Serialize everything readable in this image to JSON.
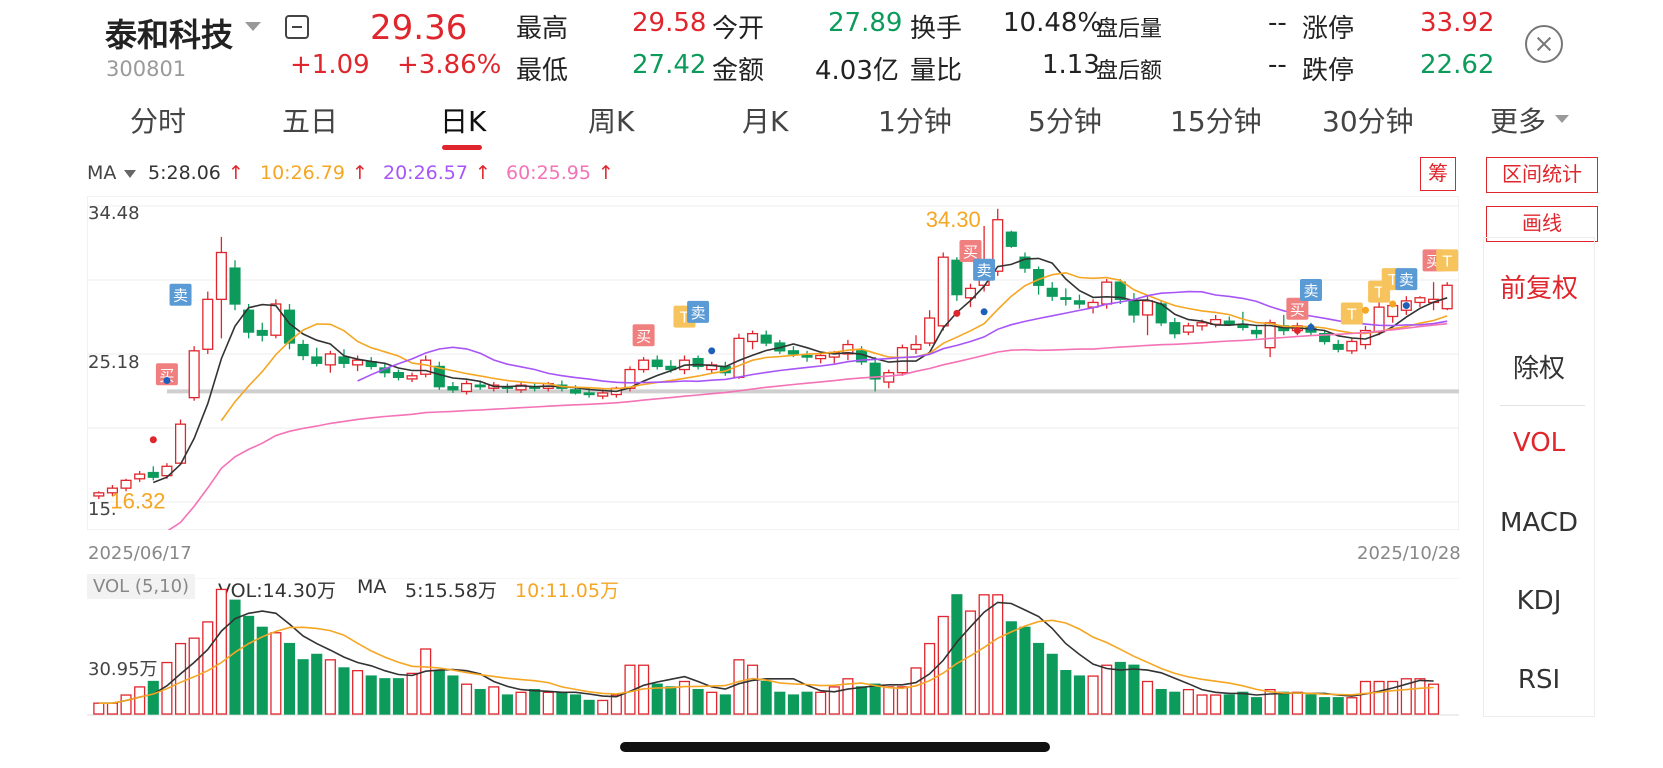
{
  "stock": {
    "name": "泰和科技",
    "code": "300801",
    "price": "29.36",
    "change": "+1.09",
    "change_pct": "+3.86%"
  },
  "quote": {
    "high_label": "最高",
    "high": "29.58",
    "low_label": "最低",
    "low": "27.42",
    "open_label": "今开",
    "open": "27.89",
    "amount_label": "金额",
    "amount": "4.03亿",
    "turnover_label": "换手",
    "turnover": "10.48%",
    "volratio_label": "量比",
    "volratio": "1.13",
    "after_vol_label": "盘后量",
    "after_vol": "--",
    "after_amt_label": "盘后额",
    "after_amt": "--",
    "limit_up_label": "涨停",
    "limit_up": "33.92",
    "limit_down_label": "跌停",
    "limit_down": "22.62"
  },
  "tabs": [
    "分时",
    "五日",
    "日K",
    "周K",
    "月K",
    "1分钟",
    "5分钟",
    "15分钟",
    "30分钟",
    "更多"
  ],
  "active_tab": "日K",
  "ma": {
    "label": "MA",
    "ma5": "5:28.06",
    "ma10": "10:26.79",
    "ma20": "20:26.57",
    "ma60": "60:25.95",
    "colors": {
      "ma5": "#333333",
      "ma10": "#f5a623",
      "ma20": "#a855f7",
      "ma60": "#f472b6"
    }
  },
  "right_buttons": {
    "chip": "筹",
    "interval_stats": "区间统计",
    "draw_line": "画线"
  },
  "side_menu": [
    "前复权",
    "除权",
    "VOL",
    "MACD",
    "KDJ",
    "RSI"
  ],
  "side_menu_active": [
    "前复权",
    "VOL"
  ],
  "axis": {
    "y_top": "34.48",
    "y_mid": "25.18",
    "y_low": "15.",
    "start_date": "2025/06/17",
    "end_date": "2025/10/28"
  },
  "annotations": {
    "max_price": "34.30",
    "min_price": "16.32",
    "buy": "买",
    "sell": "卖",
    "t": "T"
  },
  "vol": {
    "badge": "VOL (5,10)",
    "value": "VOL:14.30万",
    "ma_label": "MA",
    "ma5": "5:15.58万",
    "ma10": "10:11.05万",
    "axis_label": "30.95万"
  },
  "colors": {
    "up": "#e0262d",
    "down": "#0d9b5c",
    "accent": "#e0262d"
  },
  "chart_data": {
    "type": "candlestick",
    "ylim": [
      15.0,
      34.48
    ],
    "candles": [
      [
        15.9,
        16.2,
        15.7,
        16.1
      ],
      [
        16.1,
        16.6,
        15.9,
        16.4
      ],
      [
        16.4,
        17.0,
        16.2,
        16.9
      ],
      [
        17.0,
        17.5,
        16.8,
        17.3
      ],
      [
        17.4,
        17.8,
        16.9,
        17.1
      ],
      [
        17.2,
        18.0,
        17.0,
        17.8
      ],
      [
        18.0,
        20.8,
        17.9,
        20.5
      ],
      [
        22.2,
        25.5,
        22.0,
        25.2
      ],
      [
        25.3,
        29.0,
        25.0,
        28.5
      ],
      [
        28.5,
        32.5,
        26.0,
        31.5
      ],
      [
        30.5,
        31.0,
        27.8,
        28.2
      ],
      [
        27.8,
        28.2,
        26.0,
        26.4
      ],
      [
        26.5,
        27.0,
        25.8,
        26.2
      ],
      [
        26.2,
        28.5,
        26.0,
        28.2
      ],
      [
        27.8,
        28.2,
        25.3,
        25.7
      ],
      [
        25.6,
        25.9,
        24.6,
        24.9
      ],
      [
        24.8,
        25.4,
        24.2,
        24.4
      ],
      [
        24.3,
        25.2,
        23.8,
        25.0
      ],
      [
        24.8,
        25.3,
        24.1,
        24.4
      ],
      [
        24.3,
        24.9,
        23.9,
        24.6
      ],
      [
        24.5,
        24.8,
        24.0,
        24.2
      ],
      [
        24.1,
        24.4,
        23.5,
        23.8
      ],
      [
        23.8,
        24.0,
        23.3,
        23.5
      ],
      [
        23.4,
        23.8,
        23.2,
        23.6
      ],
      [
        23.7,
        24.9,
        23.5,
        24.6
      ],
      [
        24.2,
        24.5,
        22.7,
        22.9
      ],
      [
        22.9,
        23.2,
        22.5,
        22.7
      ],
      [
        22.6,
        23.3,
        22.4,
        23.1
      ],
      [
        23.0,
        23.3,
        22.7,
        22.9
      ],
      [
        22.8,
        23.2,
        22.6,
        23.0
      ],
      [
        22.9,
        23.1,
        22.5,
        22.8
      ],
      [
        22.7,
        23.2,
        22.5,
        23.0
      ],
      [
        22.9,
        23.1,
        22.6,
        22.8
      ],
      [
        22.8,
        23.2,
        22.6,
        23.1
      ],
      [
        23.0,
        23.3,
        22.6,
        22.8
      ],
      [
        22.7,
        23.0,
        22.4,
        22.5
      ],
      [
        22.5,
        22.8,
        22.2,
        22.4
      ],
      [
        22.3,
        22.7,
        22.1,
        22.5
      ],
      [
        22.4,
        22.9,
        22.2,
        22.8
      ],
      [
        22.8,
        24.2,
        22.6,
        24.0
      ],
      [
        24.0,
        24.8,
        23.8,
        24.6
      ],
      [
        24.6,
        24.9,
        24.0,
        24.2
      ],
      [
        24.2,
        24.6,
        23.8,
        24.0
      ],
      [
        24.0,
        24.9,
        23.7,
        24.6
      ],
      [
        24.7,
        24.9,
        24.0,
        24.2
      ],
      [
        24.0,
        24.5,
        23.8,
        24.3
      ],
      [
        24.2,
        24.5,
        23.6,
        23.8
      ],
      [
        23.5,
        26.3,
        23.4,
        26.0
      ],
      [
        25.8,
        26.5,
        25.3,
        26.3
      ],
      [
        26.2,
        26.5,
        25.5,
        25.7
      ],
      [
        25.7,
        25.9,
        25.0,
        25.2
      ],
      [
        25.2,
        25.5,
        24.8,
        25.0
      ],
      [
        24.9,
        25.2,
        24.5,
        24.8
      ],
      [
        24.7,
        25.1,
        24.4,
        24.9
      ],
      [
        24.8,
        25.2,
        24.4,
        25.1
      ],
      [
        25.0,
        25.9,
        24.6,
        25.6
      ],
      [
        25.2,
        25.5,
        24.3,
        24.5
      ],
      [
        24.4,
        24.8,
        22.6,
        23.4
      ],
      [
        23.2,
        24.0,
        22.8,
        23.8
      ],
      [
        23.8,
        25.6,
        23.6,
        25.4
      ],
      [
        25.3,
        26.2,
        25.0,
        25.6
      ],
      [
        25.7,
        27.8,
        25.5,
        27.3
      ],
      [
        26.8,
        31.5,
        26.5,
        31.2
      ],
      [
        31.0,
        31.2,
        28.4,
        28.8
      ],
      [
        28.6,
        29.5,
        28.0,
        29.2
      ],
      [
        29.4,
        33.2,
        29.0,
        30.2
      ],
      [
        30.3,
        34.3,
        30.0,
        33.6
      ],
      [
        32.8,
        32.9,
        31.8,
        31.9
      ],
      [
        31.2,
        31.5,
        30.2,
        30.5
      ],
      [
        30.4,
        30.6,
        28.8,
        29.4
      ],
      [
        29.2,
        29.6,
        28.4,
        28.7
      ],
      [
        28.6,
        29.2,
        28.1,
        28.5
      ],
      [
        28.4,
        28.8,
        27.9,
        28.2
      ],
      [
        28.0,
        28.5,
        27.6,
        28.3
      ],
      [
        28.2,
        29.8,
        27.9,
        29.6
      ],
      [
        29.6,
        29.8,
        28.2,
        28.5
      ],
      [
        28.4,
        28.9,
        27.0,
        27.5
      ],
      [
        27.5,
        28.8,
        26.2,
        28.4
      ],
      [
        28.2,
        28.4,
        26.8,
        27.0
      ],
      [
        27.0,
        27.3,
        26.0,
        26.3
      ],
      [
        26.4,
        27.0,
        26.2,
        26.8
      ],
      [
        26.8,
        27.2,
        26.5,
        27.0
      ],
      [
        26.9,
        27.5,
        26.7,
        27.2
      ],
      [
        27.1,
        27.4,
        26.8,
        26.9
      ],
      [
        26.9,
        27.7,
        26.5,
        26.7
      ],
      [
        26.5,
        26.8,
        26.0,
        26.3
      ],
      [
        25.4,
        27.2,
        24.8,
        27.0
      ],
      [
        26.8,
        27.5,
        26.2,
        26.5
      ],
      [
        26.5,
        27.0,
        26.2,
        26.8
      ],
      [
        26.7,
        27.0,
        26.2,
        26.4
      ],
      [
        26.3,
        26.5,
        25.6,
        25.8
      ],
      [
        25.6,
        25.9,
        25.1,
        25.3
      ],
      [
        25.2,
        26.0,
        25.0,
        25.8
      ],
      [
        25.6,
        26.8,
        25.3,
        26.5
      ],
      [
        26.4,
        28.3,
        26.2,
        28.0
      ],
      [
        27.4,
        28.3,
        27.0,
        28.1
      ],
      [
        27.8,
        28.7,
        27.5,
        28.4
      ],
      [
        28.3,
        28.7,
        28.0,
        28.6
      ],
      [
        28.3,
        29.6,
        27.8,
        28.5
      ],
      [
        27.9,
        29.6,
        27.8,
        29.4
      ]
    ],
    "volumes": [
      2.0,
      2.0,
      3.5,
      5.0,
      6.0,
      9.5,
      13.0,
      14.0,
      17.0,
      23.0,
      21.0,
      18.0,
      16.0,
      15.0,
      13.0,
      10.0,
      11.0,
      10.0,
      8.5,
      8.0,
      7.0,
      6.5,
      6.5,
      7.5,
      12.0,
      8.0,
      7.0,
      5.5,
      4.5,
      5.0,
      3.5,
      4.0,
      4.5,
      4.0,
      4.0,
      3.5,
      2.5,
      2.5,
      3.5,
      9.0,
      9.0,
      5.5,
      5.0,
      6.0,
      4.5,
      4.0,
      3.5,
      10.0,
      9.0,
      6.0,
      4.0,
      3.5,
      4.0,
      4.0,
      5.0,
      6.5,
      5.0,
      5.5,
      5.0,
      5.0,
      8.5,
      13.0,
      18.0,
      22.0,
      19.0,
      22.0,
      22.0,
      17.0,
      16.0,
      13.0,
      11.0,
      8.0,
      7.0,
      7.0,
      9.0,
      9.5,
      9.0,
      6.0,
      4.5,
      4.0,
      4.5,
      3.5,
      3.5,
      3.5,
      4.0,
      3.0,
      4.5,
      4.0,
      4.0,
      3.5,
      3.0,
      3.0,
      3.0,
      6.0,
      6.0,
      6.0,
      6.5,
      6.5,
      5.5
    ]
  }
}
